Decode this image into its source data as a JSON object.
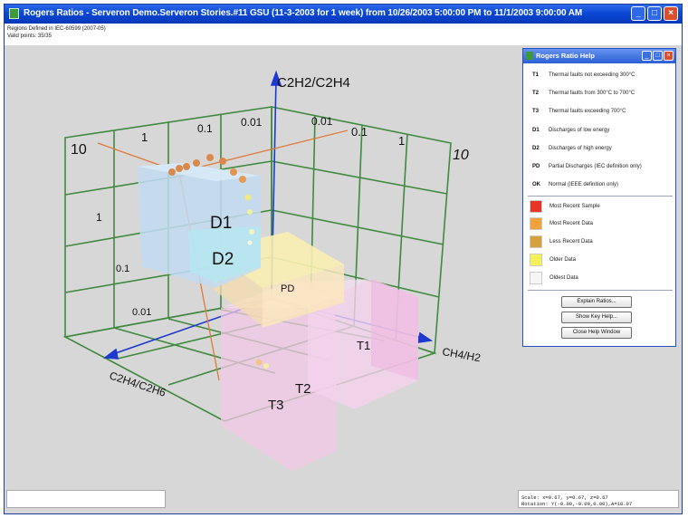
{
  "window": {
    "title": "Rogers Ratios - Serveron Demo.Serveron Stories.#11 GSU (11-3-2003 for 1 week) from 10/26/2003 5:00:00 PM to 11/1/2003 9:00:00 AM",
    "buttons": {
      "minimize": "_",
      "maximize": "□",
      "close": "×"
    }
  },
  "info": {
    "regions": "Regions Defined in IEC-60599 (2007-05)",
    "valid_points": "Valid points: 35/35"
  },
  "axes": {
    "vertical": "C2H2/C2H4",
    "right": "CH4/H2",
    "left": "C2H4/C2H6"
  },
  "ticks": {
    "top_left": [
      "10",
      "1",
      "0.1",
      "0.01"
    ],
    "top_right": [
      "0.01",
      "0.1",
      "1",
      "10"
    ],
    "left_edge": [
      "1",
      "0.1",
      "0.01"
    ]
  },
  "regions": [
    "D1",
    "D2",
    "PD",
    "T1",
    "T2",
    "T3"
  ],
  "status": {
    "scale": "Scale: x=0.67, y=0.67, z=0.67",
    "rotation": "Rotation: Y(-0.00,-0.00,0.00),A=18.07"
  },
  "help": {
    "title": "Rogers Ratio Help",
    "codes": [
      {
        "code": "T1",
        "desc": "Thermal faults not exceeding 300°C"
      },
      {
        "code": "T2",
        "desc": "Thermal faults from 300°C to 700°C"
      },
      {
        "code": "T3",
        "desc": "Thermal faults exceeding 700°C"
      },
      {
        "code": "D1",
        "desc": "Discharges of low energy"
      },
      {
        "code": "D2",
        "desc": "Discharges of high energy"
      },
      {
        "code": "PD",
        "desc": "Partial Discharges (IEC definition only)"
      },
      {
        "code": "OK",
        "desc": "Normal (IEEE definition only)"
      }
    ],
    "legend": [
      {
        "label": "Most Recent Sample",
        "color": "#e8352a"
      },
      {
        "label": "Most Recent Data",
        "color": "#f2a23a"
      },
      {
        "label": "Less Recent Data",
        "color": "#d4a13c"
      },
      {
        "label": "Older Data",
        "color": "#f4f25a"
      },
      {
        "label": "Oldest Data",
        "color": "#f6f6f6"
      }
    ],
    "buttons": {
      "explain": "Explain Ratios...",
      "keys": "Show Key Help...",
      "close": "Close Help Window"
    }
  },
  "colors": {
    "grid": "#3f8a3f",
    "axis": "#1d39d0",
    "accent_line": "#e07a3a"
  }
}
